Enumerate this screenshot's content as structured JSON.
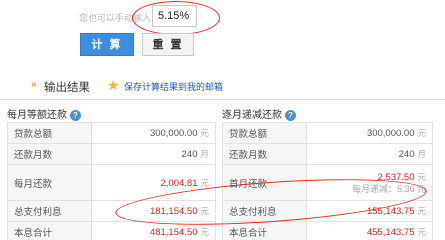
{
  "form": {
    "hint": "您也可以手动输入",
    "rate_value": "5.15%",
    "calc_label": "计 算",
    "reset_label": "重 置"
  },
  "output": {
    "arrow": "»",
    "title": "输出结果",
    "save_link": "保存计算结果到我的邮箱"
  },
  "equal_payment": {
    "title": "每月等额还款",
    "rows": [
      {
        "label": "贷款总额",
        "value": "300,000.00",
        "unit": "元"
      },
      {
        "label": "还款月数",
        "value": "240",
        "unit": "月"
      },
      {
        "label": "每月还款",
        "value": "2,004.81",
        "unit": "元"
      },
      {
        "label": "总支付利息",
        "value": "181,154.50",
        "unit": "元"
      },
      {
        "label": "本息合计",
        "value": "481,154.50",
        "unit": "元"
      }
    ]
  },
  "decreasing_payment": {
    "title": "逐月递减还款",
    "rows": [
      {
        "label": "贷款总额",
        "value": "300,000.00",
        "unit": "元"
      },
      {
        "label": "还款月数",
        "value": "240",
        "unit": "月"
      },
      {
        "label": "首月还款",
        "value": "2,537.50",
        "unit": "元",
        "sub": "每月递减：5.36 元"
      },
      {
        "label": "总支付利息",
        "value": "155,143.75",
        "unit": "元"
      },
      {
        "label": "本息合计",
        "value": "455,143.75",
        "unit": "元"
      }
    ]
  },
  "colors": {
    "accent_blue": "#3d8ee0",
    "value_red": "#d8262a",
    "annotation_red": "#e22a2a"
  },
  "icons": {
    "help": "question-circle-icon",
    "star": "star-icon",
    "arrow": "double-chevron-right-icon"
  }
}
